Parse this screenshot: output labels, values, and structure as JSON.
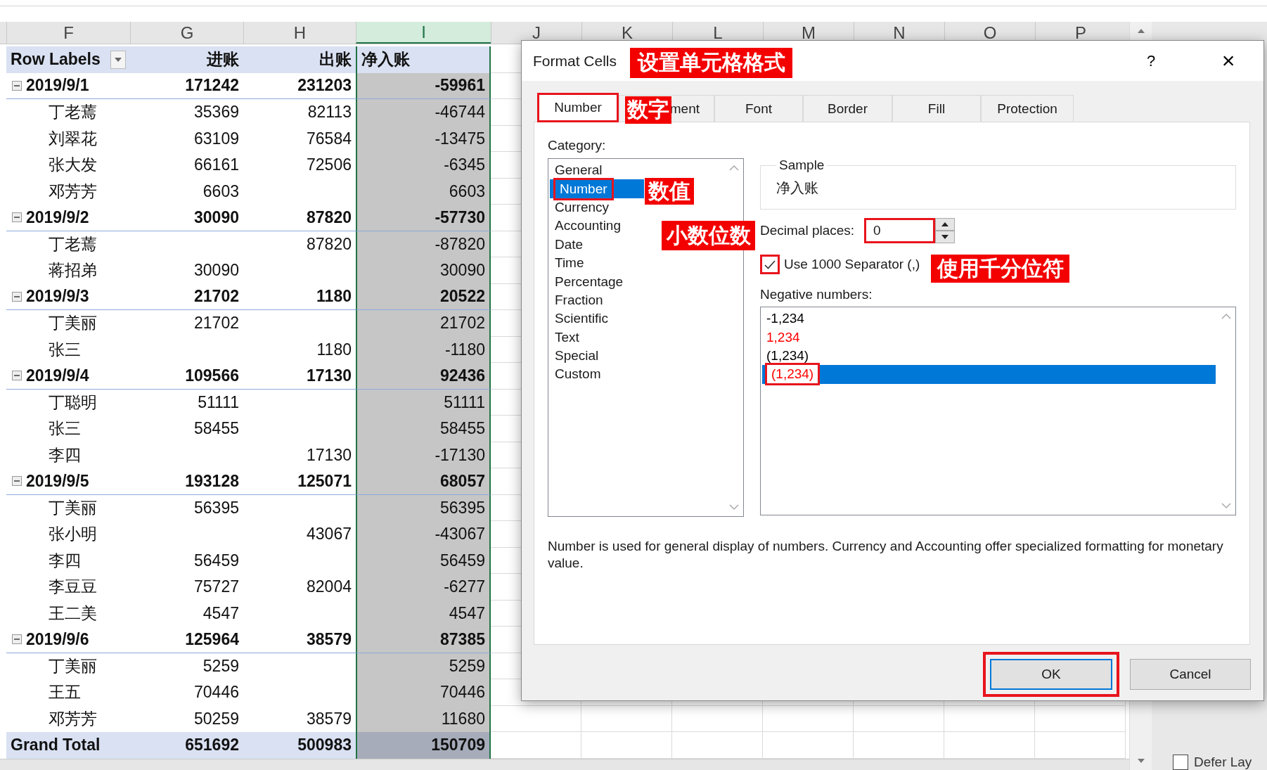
{
  "spreadsheet": {
    "column_headers": [
      {
        "label": "F",
        "selected": false
      },
      {
        "label": "G",
        "selected": false
      },
      {
        "label": "H",
        "selected": false
      },
      {
        "label": "I",
        "selected": true
      },
      {
        "label": "J",
        "selected": false
      },
      {
        "label": "K",
        "selected": false
      },
      {
        "label": "L",
        "selected": false
      },
      {
        "label": "M",
        "selected": false
      },
      {
        "label": "N",
        "selected": false
      },
      {
        "label": "O",
        "selected": false
      },
      {
        "label": "P",
        "selected": false
      }
    ],
    "pivot": {
      "row_labels": "Row Labels",
      "columns": [
        "进账",
        "出账",
        "净入账"
      ],
      "groups": [
        {
          "date": "2019/9/1",
          "expanded": true,
          "values": {
            "income": "171242",
            "expense": "231203",
            "net": "-59961"
          },
          "children": [
            {
              "name": "丁老蔫",
              "values": {
                "income": "35369",
                "expense": "82113",
                "net": "-46744"
              }
            },
            {
              "name": "刘翠花",
              "values": {
                "income": "63109",
                "expense": "76584",
                "net": "-13475"
              }
            },
            {
              "name": "张大发",
              "values": {
                "income": "66161",
                "expense": "72506",
                "net": "-6345"
              }
            },
            {
              "name": "邓芳芳",
              "values": {
                "income": "6603",
                "net": "6603"
              }
            }
          ]
        },
        {
          "date": "2019/9/2",
          "expanded": true,
          "values": {
            "income": "30090",
            "expense": "87820",
            "net": "-57730"
          },
          "children": [
            {
              "name": "丁老蔫",
              "values": {
                "expense": "87820",
                "net": "-87820"
              }
            },
            {
              "name": "蒋招弟",
              "values": {
                "income": "30090",
                "net": "30090"
              }
            }
          ]
        },
        {
          "date": "2019/9/3",
          "expanded": true,
          "values": {
            "income": "21702",
            "expense": "1180",
            "net": "20522"
          },
          "children": [
            {
              "name": "丁美丽",
              "values": {
                "income": "21702",
                "net": "21702"
              }
            },
            {
              "name": "张三",
              "values": {
                "expense": "1180",
                "net": "-1180"
              }
            }
          ]
        },
        {
          "date": "2019/9/4",
          "expanded": true,
          "values": {
            "income": "109566",
            "expense": "17130",
            "net": "92436"
          },
          "children": [
            {
              "name": "丁聪明",
              "values": {
                "income": "51111",
                "net": "51111"
              }
            },
            {
              "name": "张三",
              "values": {
                "income": "58455",
                "net": "58455"
              }
            },
            {
              "name": "李四",
              "values": {
                "expense": "17130",
                "net": "-17130"
              }
            }
          ]
        },
        {
          "date": "2019/9/5",
          "expanded": true,
          "values": {
            "income": "193128",
            "expense": "125071",
            "net": "68057"
          },
          "children": [
            {
              "name": "丁美丽",
              "values": {
                "income": "56395",
                "net": "56395"
              }
            },
            {
              "name": "张小明",
              "values": {
                "expense": "43067",
                "net": "-43067"
              }
            },
            {
              "name": "李四",
              "values": {
                "income": "56459",
                "net": "56459"
              }
            },
            {
              "name": "李豆豆",
              "values": {
                "income": "75727",
                "expense": "82004",
                "net": "-6277"
              }
            },
            {
              "name": "王二美",
              "values": {
                "income": "4547",
                "net": "4547"
              }
            }
          ]
        },
        {
          "date": "2019/9/6",
          "expanded": true,
          "values": {
            "income": "125964",
            "expense": "38579",
            "net": "87385"
          },
          "children": [
            {
              "name": "丁美丽",
              "values": {
                "income": "5259",
                "net": "5259"
              }
            },
            {
              "name": "王五",
              "values": {
                "income": "70446",
                "net": "70446"
              }
            },
            {
              "name": "邓芳芳",
              "values": {
                "income": "50259",
                "expense": "38579",
                "net": "11680"
              }
            }
          ]
        }
      ],
      "grand_total": {
        "label": "Grand Total",
        "values": {
          "income": "651692",
          "expense": "500983",
          "net": "150709"
        }
      }
    }
  },
  "pivot_pane": {
    "defer_label": "Defer Lay",
    "defer_checked": false
  },
  "dialog": {
    "title": "Format Cells",
    "help": "?",
    "close": "×",
    "tabs": [
      {
        "label": "Number",
        "selected": true,
        "highlighted": true,
        "covered": false
      },
      {
        "label": "ment",
        "selected": false,
        "highlighted": false,
        "covered": true
      },
      {
        "label": "Font",
        "selected": false,
        "highlighted": false,
        "covered": false
      },
      {
        "label": "Border",
        "selected": false,
        "highlighted": false,
        "covered": false
      },
      {
        "label": "Fill",
        "selected": false,
        "highlighted": false,
        "covered": false
      },
      {
        "label": "Protection",
        "selected": false,
        "highlighted": false,
        "covered": false
      }
    ],
    "category_label": "Category:",
    "categories": [
      {
        "label": "General",
        "selected": false,
        "highlighted": false
      },
      {
        "label": "Number",
        "selected": true,
        "highlighted": true
      },
      {
        "label": "Currency",
        "selected": false,
        "highlighted": false
      },
      {
        "label": "Accounting",
        "selected": false,
        "highlighted": false
      },
      {
        "label": "Date",
        "selected": false,
        "highlighted": false
      },
      {
        "label": "Time",
        "selected": false,
        "highlighted": false
      },
      {
        "label": "Percentage",
        "selected": false,
        "highlighted": false
      },
      {
        "label": "Fraction",
        "selected": false,
        "highlighted": false
      },
      {
        "label": "Scientific",
        "selected": false,
        "highlighted": false
      },
      {
        "label": "Text",
        "selected": false,
        "highlighted": false
      },
      {
        "label": "Special",
        "selected": false,
        "highlighted": false
      },
      {
        "label": "Custom",
        "selected": false,
        "highlighted": false
      }
    ],
    "sample": {
      "legend": "Sample",
      "value": "净入账"
    },
    "decimal_places": {
      "label": "Decimal places:",
      "value": "0",
      "highlighted": true
    },
    "separator": {
      "label": "Use 1000 Separator (,)",
      "checked": true,
      "highlighted": true
    },
    "negative_label": "Negative numbers:",
    "negative_numbers": [
      {
        "label": "-1,234",
        "color": "#000000",
        "selected": false,
        "highlighted": false
      },
      {
        "label": "1,234",
        "color": "#ff0000",
        "selected": false,
        "highlighted": false
      },
      {
        "label": "(1,234)",
        "color": "#000000",
        "selected": false,
        "highlighted": false
      },
      {
        "label": "(1,234)",
        "color": "#ff0000",
        "selected": true,
        "highlighted": true
      }
    ],
    "description": "Number is used for general display of numbers.  Currency and Accounting offer specialized formatting for monetary value.",
    "buttons": [
      {
        "label": "OK",
        "default": true,
        "highlighted": true
      },
      {
        "label": "Cancel",
        "default": false,
        "highlighted": false
      }
    ]
  },
  "annotations": [
    "设置单元格格式",
    "数字",
    "数值",
    "小数位数",
    "使用千分位符"
  ]
}
